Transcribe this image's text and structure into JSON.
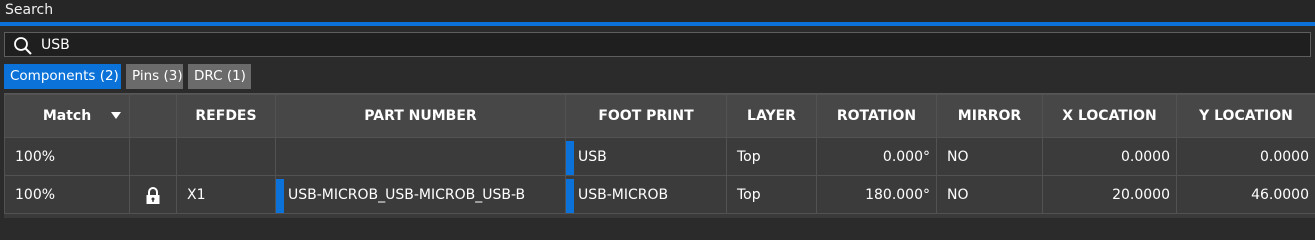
{
  "window": {
    "title": "Search"
  },
  "search": {
    "value": "USB",
    "placeholder": ""
  },
  "tabs": [
    {
      "label": "Components (2)",
      "active": true
    },
    {
      "label": "Pins (3)",
      "active": false
    },
    {
      "label": "DRC (1)",
      "active": false
    }
  ],
  "table": {
    "columns": [
      "Match",
      "",
      "REFDES",
      "PART NUMBER",
      "FOOT PRINT",
      "LAYER",
      "ROTATION",
      "MIRROR",
      "X LOCATION",
      "Y LOCATION"
    ],
    "rows": [
      {
        "match": "100%",
        "locked": false,
        "refdes": "",
        "part_number": "",
        "footprint": "USB",
        "layer": "Top",
        "rotation": "0.000°",
        "mirror": "NO",
        "x": "0.0000",
        "y": "0.0000"
      },
      {
        "match": "100%",
        "locked": true,
        "refdes": "X1",
        "part_number": "USB-MICROB_USB-MICROB_USB-B",
        "footprint": "USB-MICROB",
        "layer": "Top",
        "rotation": "180.000°",
        "mirror": "NO",
        "x": "20.0000",
        "y": "46.0000"
      }
    ]
  },
  "icons": {
    "search": "search-icon",
    "lock": "lock-icon",
    "sort": "chevron-down-icon"
  },
  "colors": {
    "accent": "#0a72d8",
    "background": "#2b2b2b",
    "tab_inactive": "#6b6b6b"
  }
}
